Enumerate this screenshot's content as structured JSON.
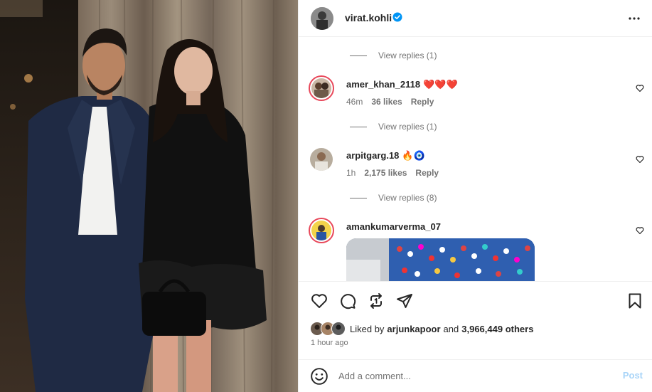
{
  "post": {
    "username": "virat.kohli",
    "verified_icon": "verified-badge-icon",
    "more_icon": "more-options-icon"
  },
  "comments": [
    {
      "view_replies": "View replies (1)"
    },
    {
      "username": "amer_khan_2118",
      "emoji": "❤️❤️❤️",
      "time": "46m",
      "likes": "36 likes",
      "reply": "Reply",
      "view_replies": "View replies (1)"
    },
    {
      "username": "arpitgarg.18",
      "emoji": "🔥🧿",
      "time": "1h",
      "likes": "2,175 likes",
      "reply": "Reply",
      "view_replies": "View replies (8)"
    },
    {
      "username": "amankumarverma_07"
    }
  ],
  "actions": {
    "like_icon": "heart-icon",
    "comment_icon": "comment-icon",
    "repost_icon": "repost-icon",
    "share_icon": "share-icon",
    "save_icon": "bookmark-icon"
  },
  "likes": {
    "prefix": "Liked by",
    "liked_by_user": "arjunkapoor",
    "and": "and",
    "others": "3,966,449 others"
  },
  "timestamp": "1 hour ago",
  "add_comment": {
    "placeholder": "Add a comment...",
    "post_label": "Post",
    "emoji_icon": "emoji-smiley-icon"
  },
  "colors": {
    "verified_blue": "#0095f6",
    "post_disabled": "#a8d4f8",
    "story_ring": "#e8485a",
    "secondary_text": "#737373"
  }
}
